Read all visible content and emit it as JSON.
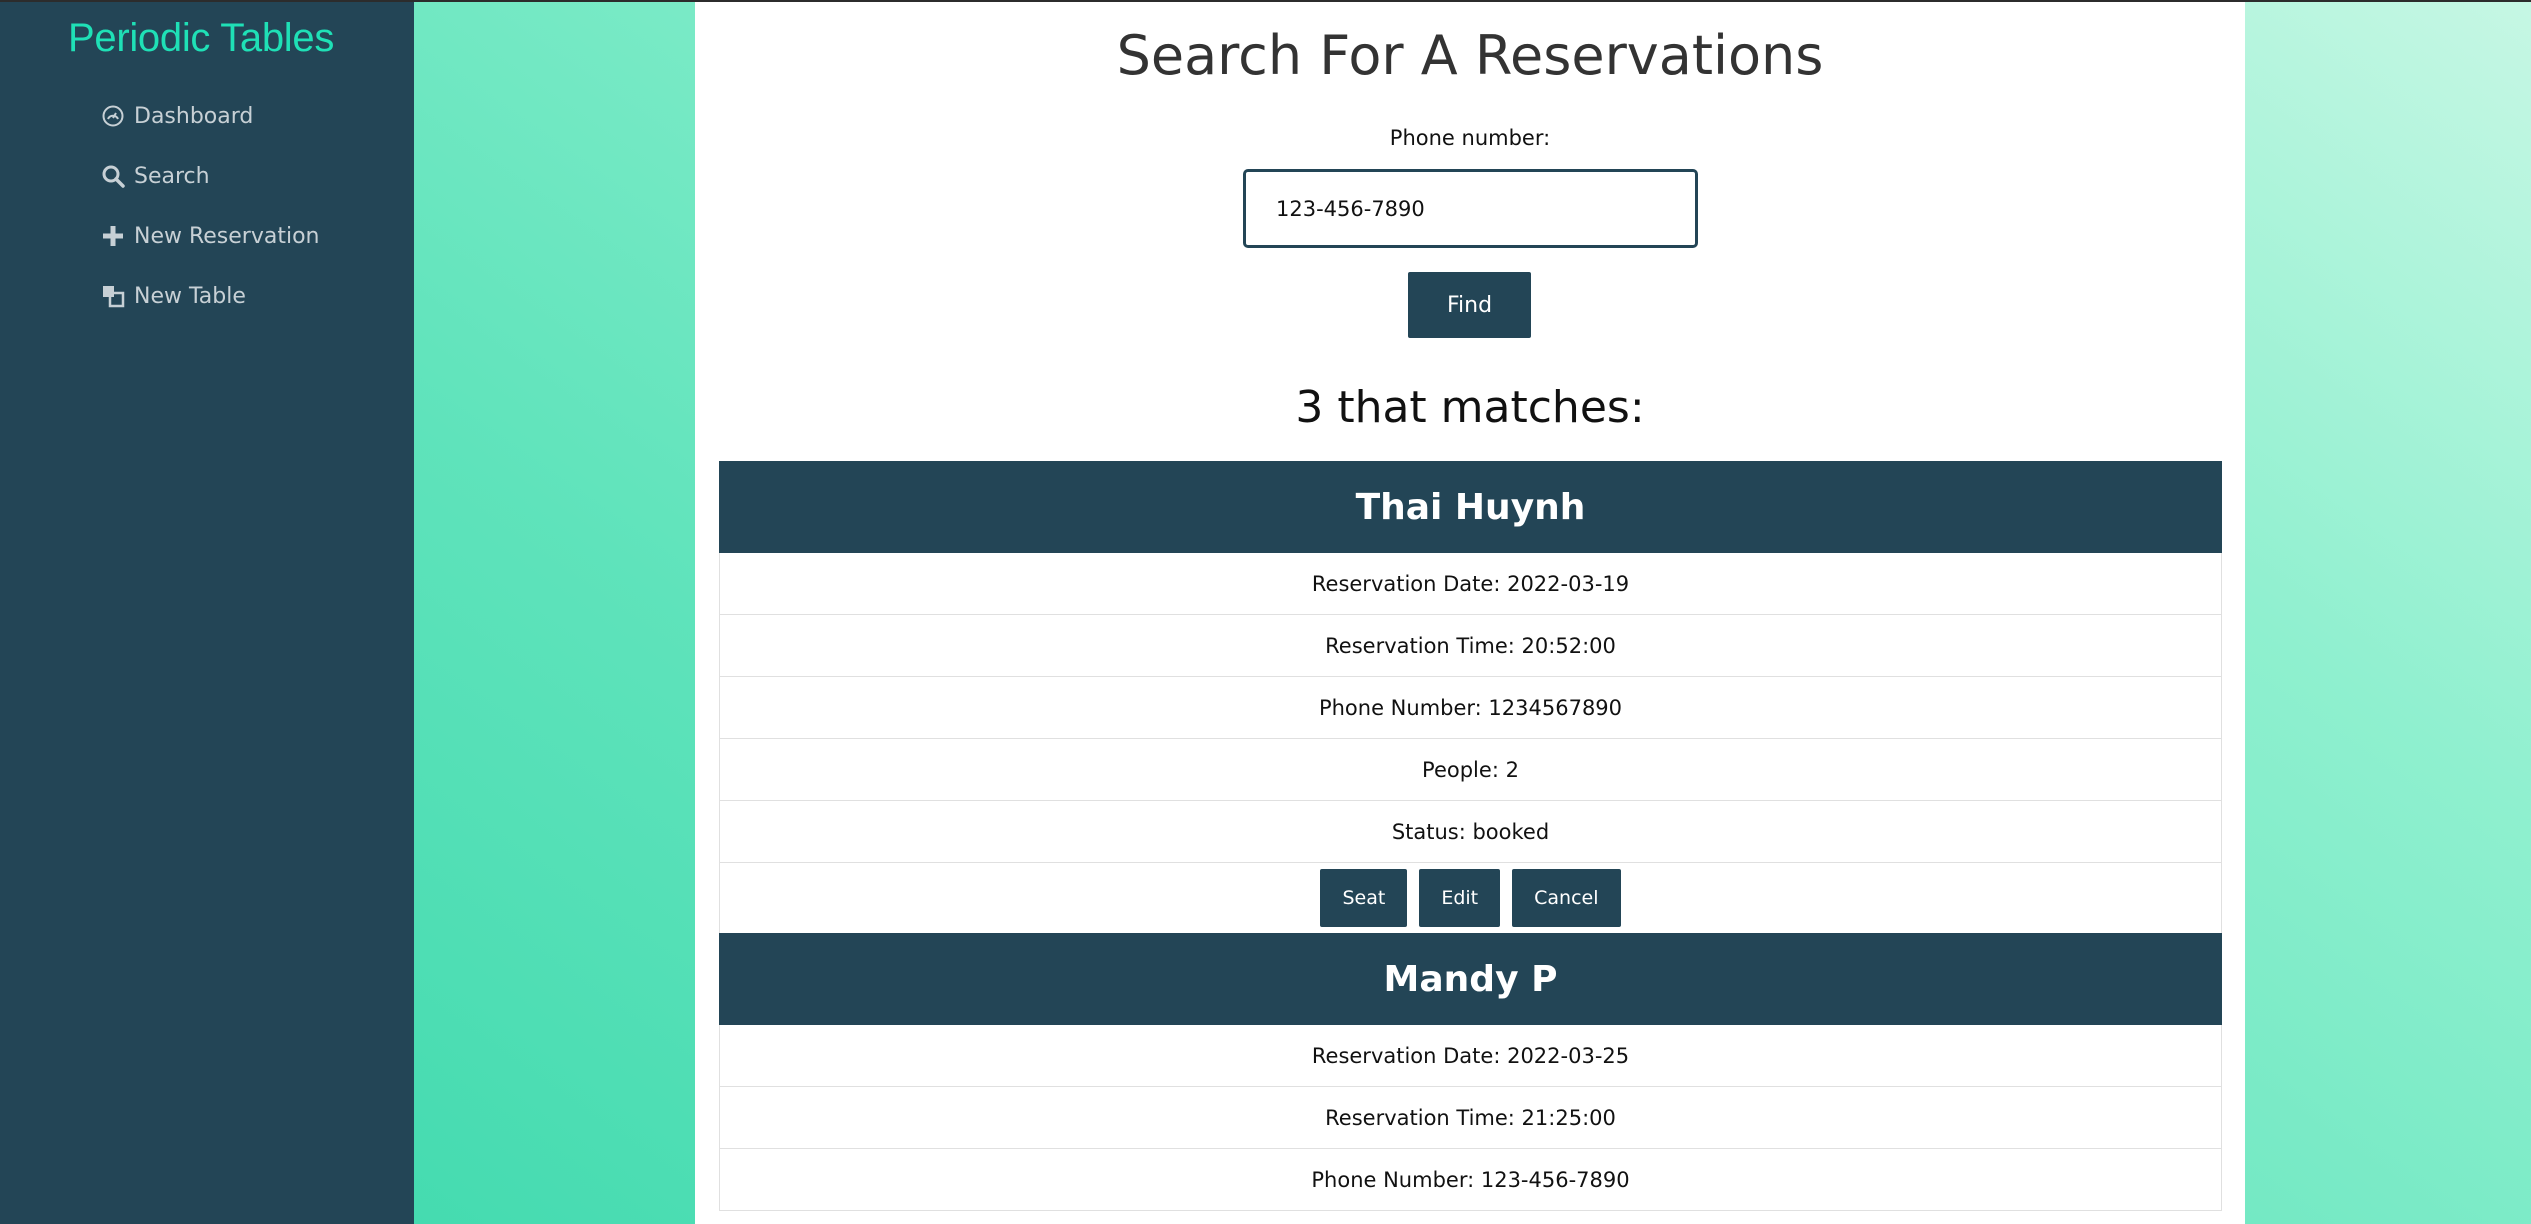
{
  "sidebar": {
    "brand": "Periodic Tables",
    "items": [
      {
        "label": "Dashboard",
        "icon": "dashboard-icon"
      },
      {
        "label": "Search",
        "icon": "search-icon"
      },
      {
        "label": "New Reservation",
        "icon": "plus-icon"
      },
      {
        "label": "New Table",
        "icon": "tables-icon"
      }
    ]
  },
  "search": {
    "title": "Search For A Reservations",
    "label": "Phone number:",
    "value": "123-456-7890",
    "button": "Find"
  },
  "results": {
    "count_text": "3 that matches:",
    "items": [
      {
        "name": "Thai Huynh",
        "date": "Reservation Date: 2022-03-19",
        "time": "Reservation Time: 20:52:00",
        "phone": "Phone Number: 1234567890",
        "people": "People: 2",
        "status": "Status: booked",
        "actions": {
          "seat": "Seat",
          "edit": "Edit",
          "cancel": "Cancel"
        }
      },
      {
        "name": "Mandy P",
        "date": "Reservation Date: 2022-03-25",
        "time": "Reservation Time: 21:25:00",
        "phone": "Phone Number: 123-456-7890"
      }
    ]
  },
  "colors": {
    "sidebar_bg": "#234556",
    "brand": "#1fe0b6",
    "nav_text": "#c7d0d5",
    "accent": "#234556",
    "gradient_light": "#c6f7e4",
    "gradient_dark": "#45dbb0"
  }
}
